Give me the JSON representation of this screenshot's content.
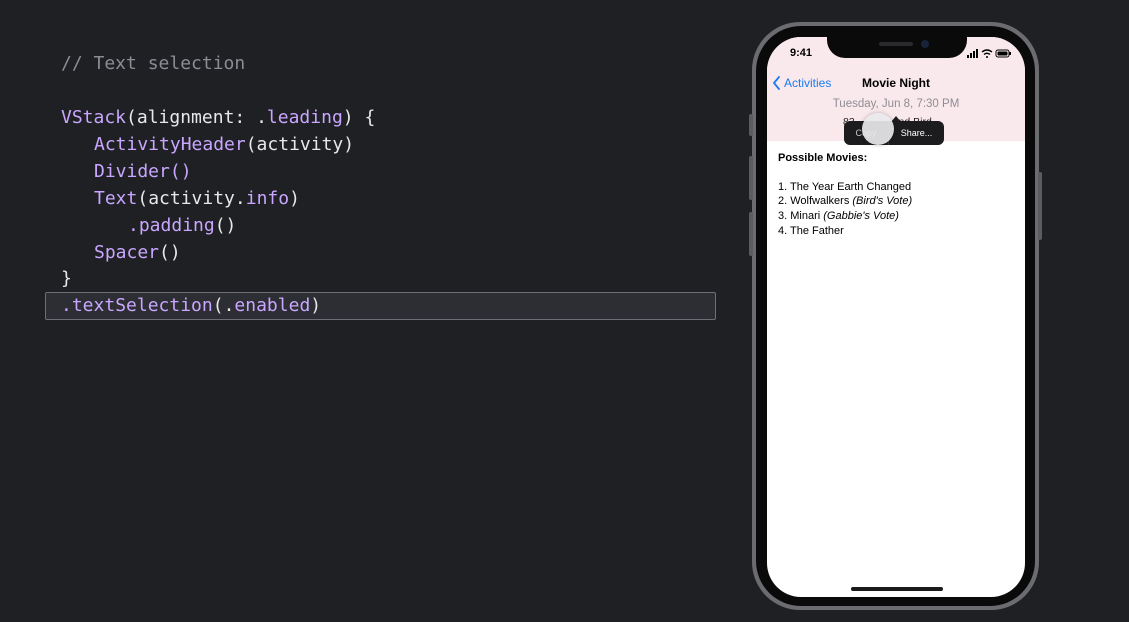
{
  "code": {
    "comment": "// Text selection",
    "vstack": "VStack",
    "vstack_args": "(alignment: .",
    "leading": "leading",
    "vstack_close": ") {",
    "header_fn": "ActivityHeader",
    "header_args": "(activity)",
    "divider_fn": "Divider",
    "divider_args": "()",
    "text_fn": "Text",
    "text_args_open": "(activity.",
    "info": "info",
    "text_args_close": ")",
    "padding_dot": ".",
    "padding_fn": "padding",
    "padding_args": "()",
    "spacer_fn": "Spacer",
    "spacer_args": "()",
    "brace_close": "}",
    "modifier_dot": ".",
    "modifier_fn": "textSelection",
    "modifier_open": "(.",
    "modifier_arg": "enabled",
    "modifier_close": ")"
  },
  "phone": {
    "status_time": "9:41",
    "nav_back": "Activities",
    "nav_title": "Movie Night",
    "date": "Tuesday, Jun 8, 7:30 PM",
    "host_visible": "83",
    "host_visible_end": "and Bird",
    "menu_copy": "Copy",
    "menu_share": "Share...",
    "heading": "Possible Movies:",
    "movies": [
      {
        "text": "1. The Year Earth Changed",
        "note": ""
      },
      {
        "text": "2. Wolfwalkers ",
        "note": "(Bird's Vote)"
      },
      {
        "text": "3. Minari ",
        "note": "(Gabbie's Vote)"
      },
      {
        "text": "4. The Father",
        "note": ""
      }
    ]
  },
  "colors": {
    "background": "#1f2023",
    "syntax_purple": "#c9a6ff",
    "comment_gray": "#8a8d93",
    "header_pink": "#f9e8ec",
    "link_blue": "#1a7cf0"
  }
}
